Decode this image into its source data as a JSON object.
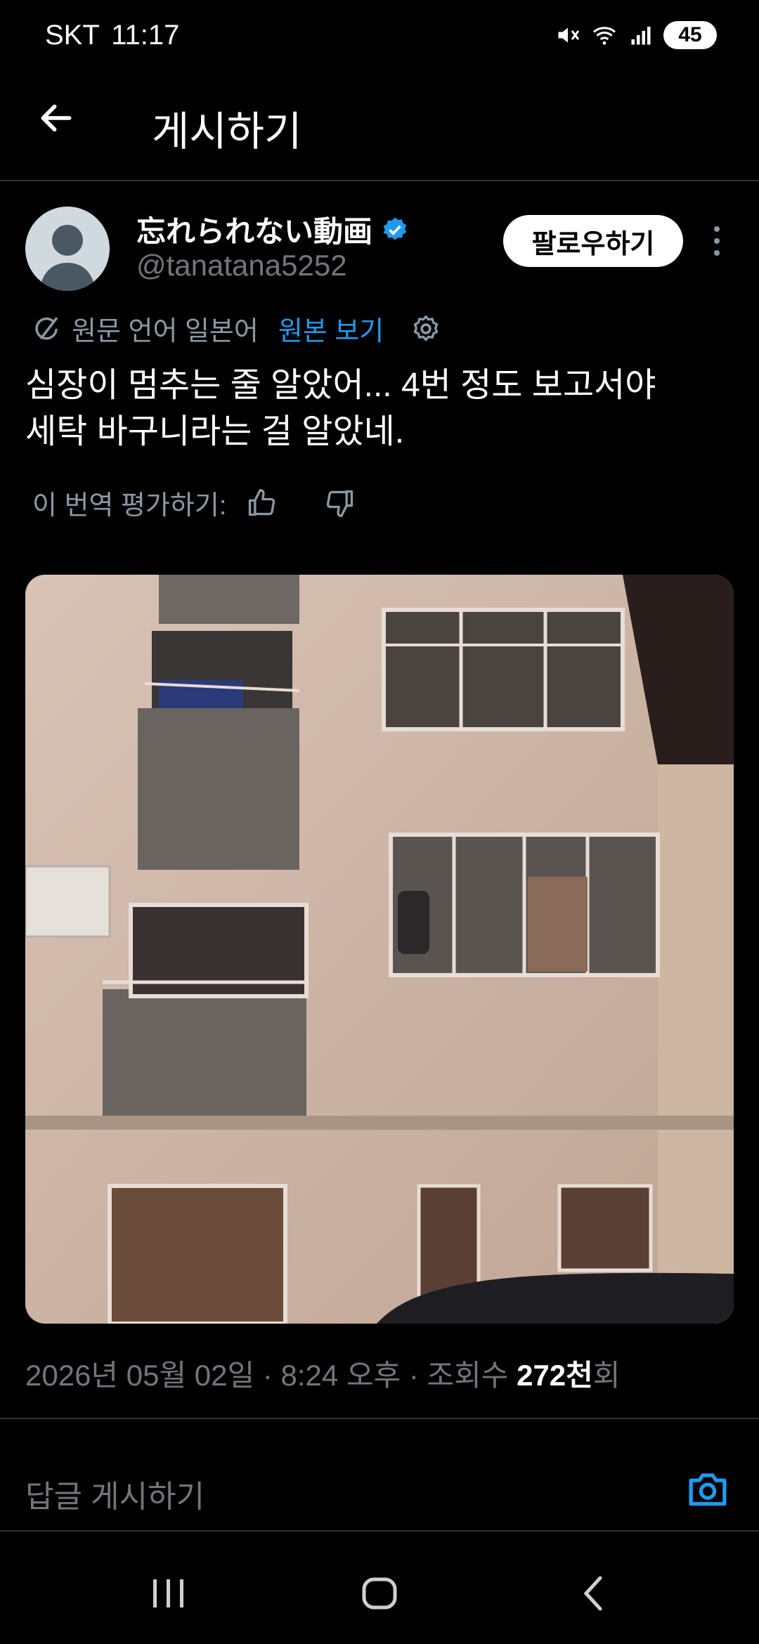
{
  "status_bar": {
    "carrier": "SKT",
    "time": "11:17",
    "battery": "45"
  },
  "header": {
    "title": "게시하기"
  },
  "author": {
    "display_name": "忘れられない動画",
    "handle": "@tanatana5252",
    "follow_label": "팔로우하기"
  },
  "translation": {
    "source_label": "원문 언어 일본어",
    "view_original": "원본 보기",
    "rate_label": "이 번역 평가하기:"
  },
  "tweet": {
    "line1": "심장이 멈추는 줄 알았어... 4번 정도 보고서야",
    "line2": "세탁 바구니라는 걸 알았네."
  },
  "meta": {
    "date": "2026년 05월 02일",
    "time": "8:24 오후",
    "views_prefix": "조회수",
    "views_count": "272천",
    "views_suffix": "회"
  },
  "reply": {
    "placeholder": "답글 게시하기"
  },
  "colors": {
    "accent": "#1d9bf0",
    "background": "#000000",
    "muted": "#71767b"
  }
}
